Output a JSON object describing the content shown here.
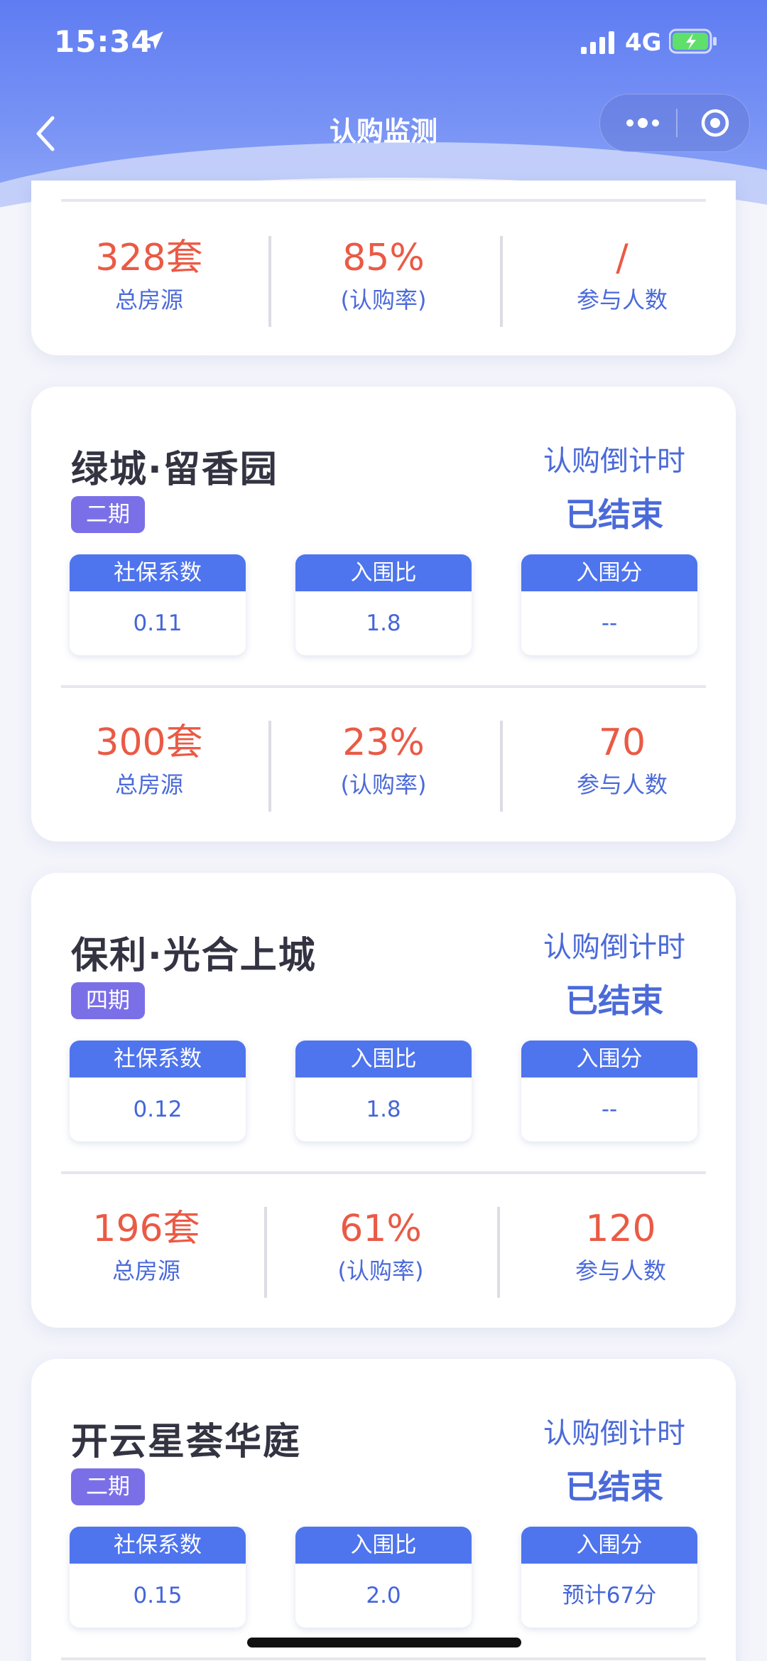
{
  "status_bar": {
    "time": "15:34",
    "network": "4G"
  },
  "nav": {
    "title": "认购监测"
  },
  "top_card": {
    "stats": [
      {
        "value": "328套",
        "label": "总房源"
      },
      {
        "value": "85%",
        "label": "(认购率)"
      },
      {
        "value": "/",
        "label": "参与人数"
      }
    ]
  },
  "projects": [
    {
      "name": "绿城·留香园",
      "phase": "二期",
      "countdown_label": "认购倒计时",
      "countdown_value": "已结束",
      "metrics": [
        {
          "label": "社保系数",
          "value": "0.11"
        },
        {
          "label": "入围比",
          "value": "1.8"
        },
        {
          "label": "入围分",
          "value": "--"
        }
      ],
      "stats": [
        {
          "value": "300套",
          "label": "总房源"
        },
        {
          "value": "23%",
          "label": "(认购率)"
        },
        {
          "value": "70",
          "label": "参与人数"
        }
      ]
    },
    {
      "name": "保利·光合上城",
      "phase": "四期",
      "countdown_label": "认购倒计时",
      "countdown_value": "已结束",
      "metrics": [
        {
          "label": "社保系数",
          "value": "0.12"
        },
        {
          "label": "入围比",
          "value": "1.8"
        },
        {
          "label": "入围分",
          "value": "--"
        }
      ],
      "stats": [
        {
          "value": "196套",
          "label": "总房源"
        },
        {
          "value": "61%",
          "label": "(认购率)"
        },
        {
          "value": "120",
          "label": "参与人数"
        }
      ]
    },
    {
      "name": "开云星荟华庭",
      "phase": "二期",
      "countdown_label": "认购倒计时",
      "countdown_value": "已结束",
      "metrics": [
        {
          "label": "社保系数",
          "value": "0.15"
        },
        {
          "label": "入围比",
          "value": "2.0"
        },
        {
          "label": "入围分",
          "value": "预计67分"
        }
      ]
    }
  ],
  "colors": {
    "accent_blue": "#4e74ee",
    "value_red": "#ea5a45",
    "badge_purple": "#7b6fe8"
  }
}
